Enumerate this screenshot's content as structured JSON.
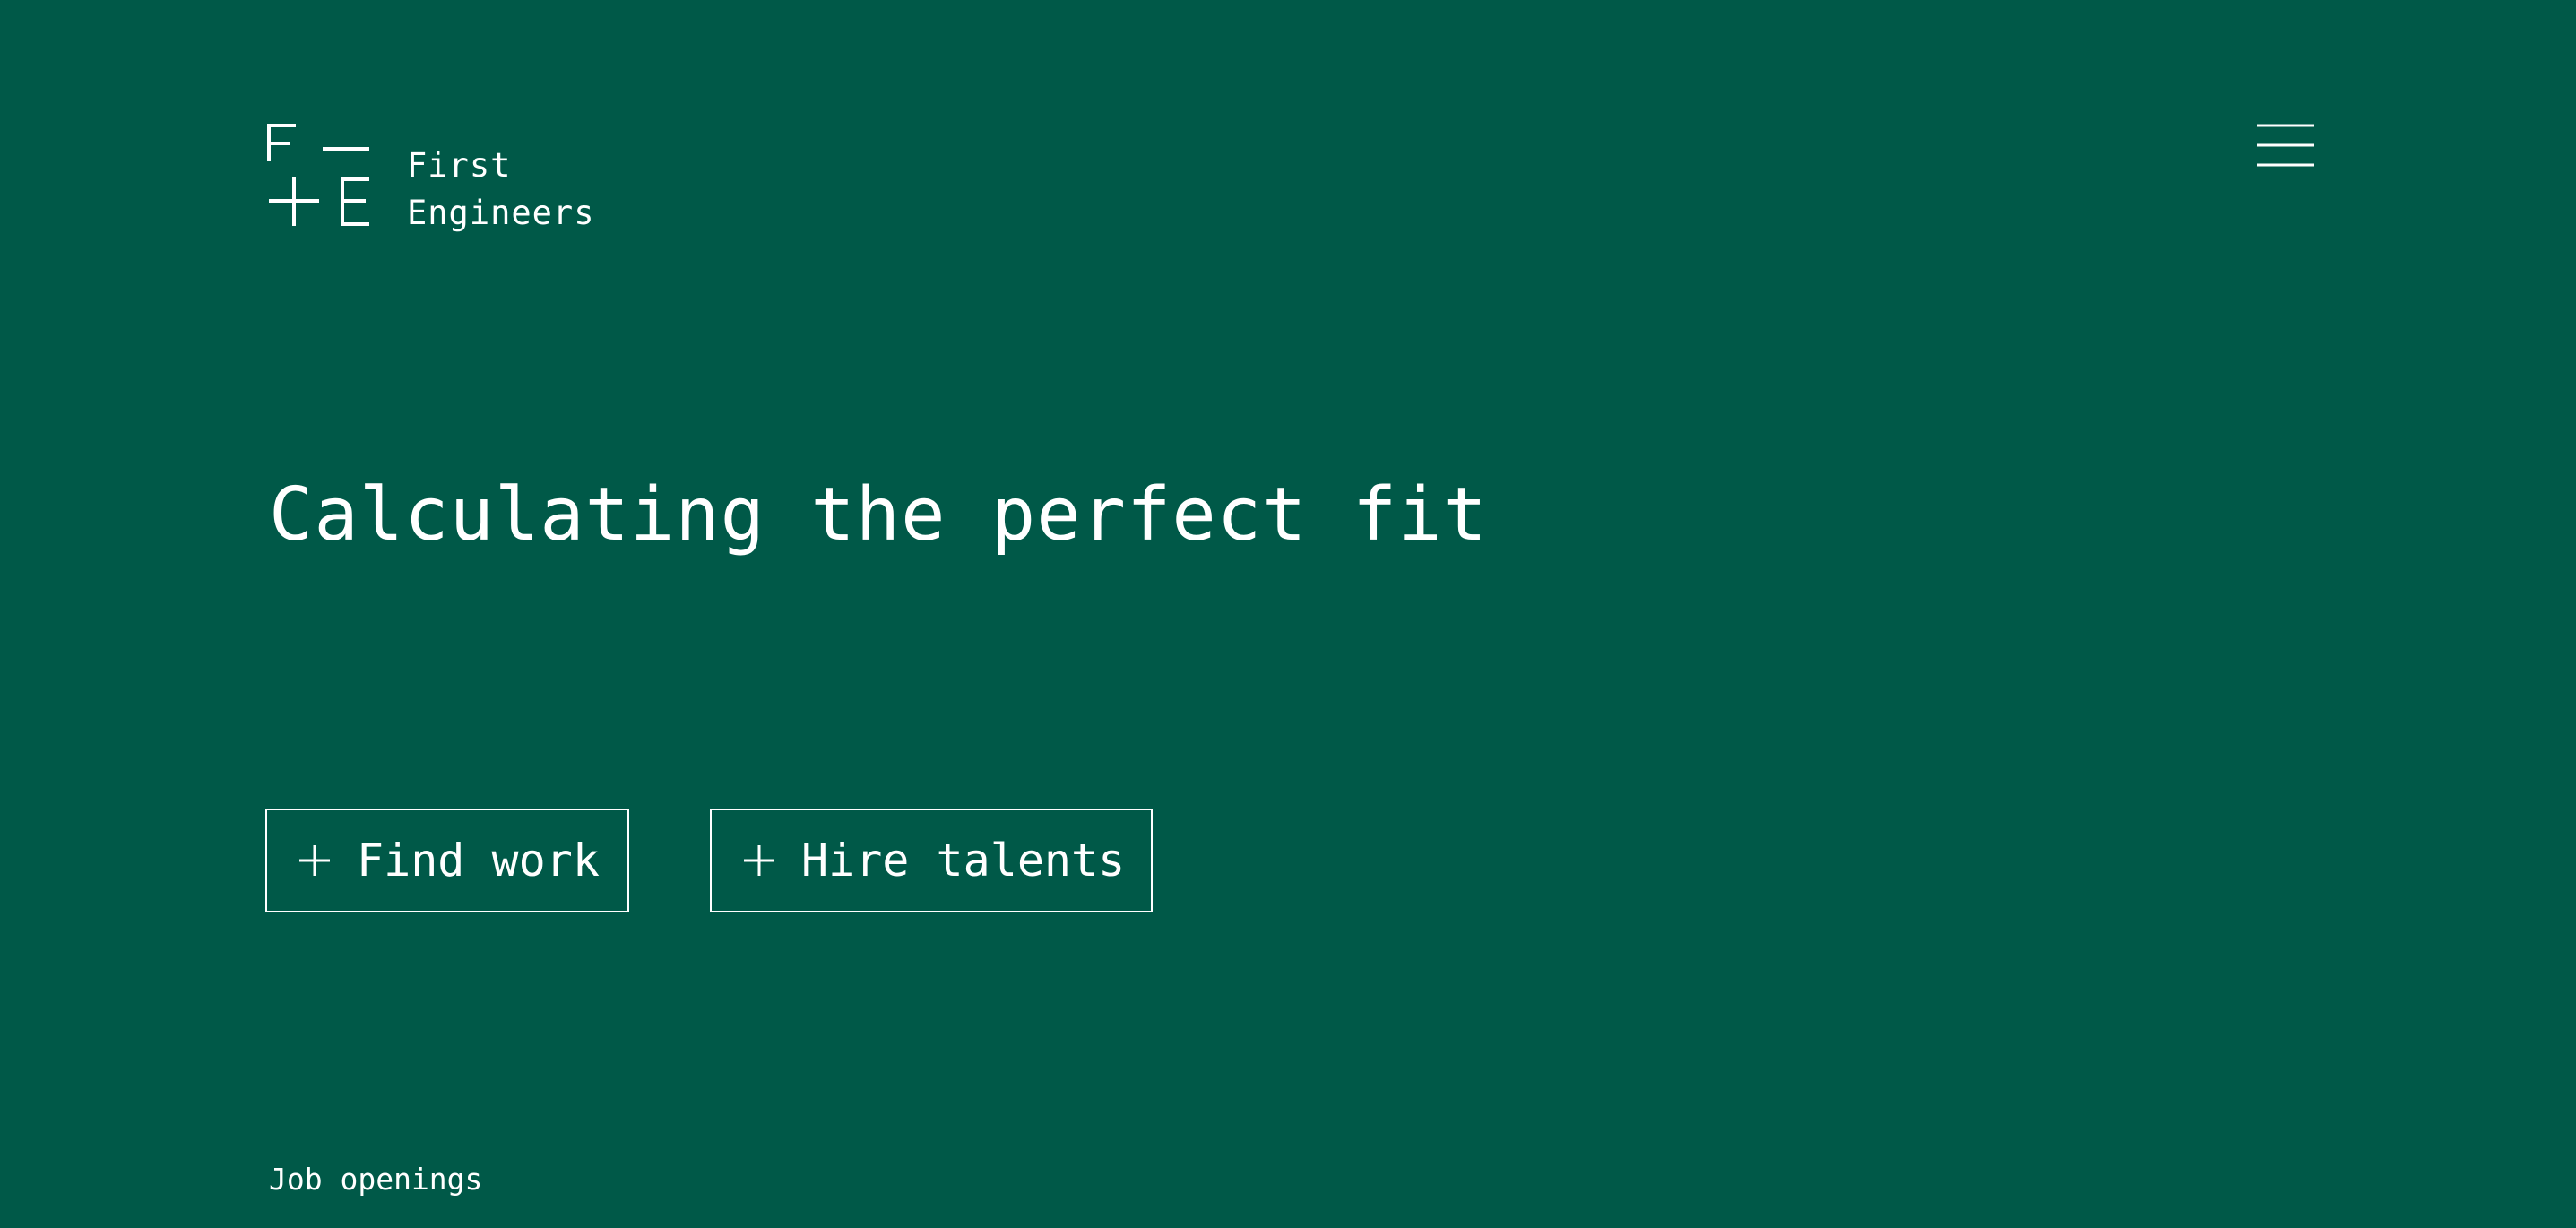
{
  "header": {
    "logo_line1": "First",
    "logo_line2": "Engineers",
    "logo_mark_icon": "first-engineers-logo-mark",
    "menu_icon": "hamburger-menu-icon"
  },
  "hero": {
    "headline": "Calculating the perfect fit"
  },
  "actions": {
    "find_work_label": "Find work",
    "hire_talents_label": "Hire talents",
    "plus_icon": "plus-icon"
  },
  "footer": {
    "job_openings_label": "Job openings"
  },
  "colors": {
    "background": "#005948",
    "foreground": "#ffffff"
  }
}
